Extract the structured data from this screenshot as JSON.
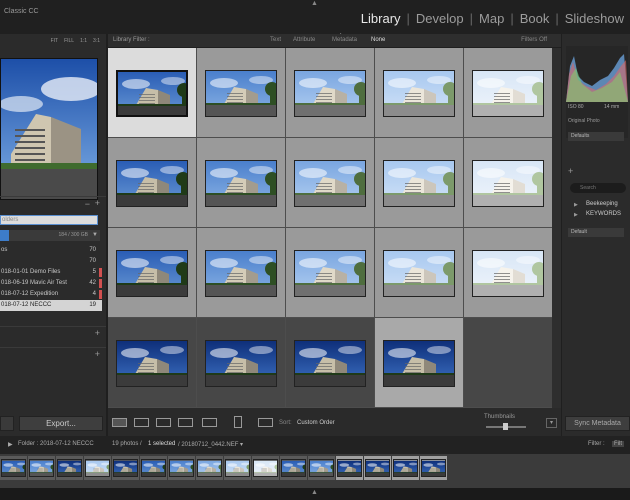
{
  "app": {
    "name": "Classic CC",
    "modules": [
      "Library",
      "Develop",
      "Map",
      "Book",
      "Slideshow"
    ],
    "active_module": "Library"
  },
  "navigator": {
    "zoom": [
      "FIT",
      "FILL",
      "1:1",
      "3:1"
    ]
  },
  "folders": {
    "search_placeholder": "olders",
    "volume": "184 / 300 GB",
    "items": [
      {
        "label": "os",
        "count": "70"
      },
      {
        "label": "",
        "count": "70"
      },
      {
        "label": "018-01-01 Demo Files",
        "count": "5"
      },
      {
        "label": "018-06-19 Mavic Air Test",
        "count": "42"
      },
      {
        "label": "018-07-12 Expedition",
        "count": "4"
      },
      {
        "label": "018-07-12 NECCC",
        "count": "19"
      }
    ]
  },
  "left_panel": {
    "plus": "+",
    "minus": "−",
    "export_label": "Export..."
  },
  "filter_bar": {
    "title": "Library Filter :",
    "options": [
      "Text",
      "Attribute",
      "Metadata",
      "None"
    ],
    "active_option": "None",
    "status": "Filters Off"
  },
  "toolbar": {
    "sort_label": "Sort:",
    "sort_value": "Custom Order",
    "thumbnails_label": "Thumbnails",
    "thumbnail_size": 0.45
  },
  "right_panel": {
    "iso": "ISO 80",
    "focal": "14 mm",
    "original_photo": "Original Photo",
    "preset1": "Defaults",
    "preset2": "Default",
    "search_placeholder": "Search",
    "keywords": [
      "Beekeeping",
      "KEYWORDS"
    ],
    "sync_label": "Sync Metadata"
  },
  "info_bar": {
    "folder": "Folder : 2018-07-12 NECCC",
    "count": "19 photos /",
    "selected": "1 selected",
    "file": "/ 20180712_0442.NEF ▾",
    "filter_label": "Filter :",
    "filter_btn": "Filt"
  },
  "colors": {
    "accent": "#3d7cc9",
    "label_red": "#d25050"
  }
}
